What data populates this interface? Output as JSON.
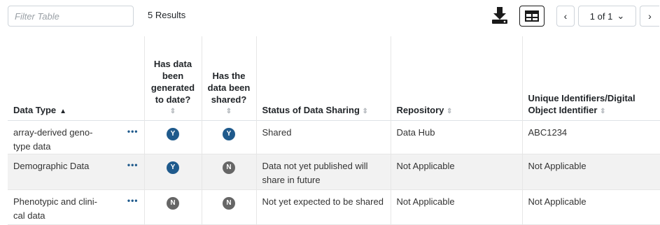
{
  "toolbar": {
    "filter_placeholder": "Filter Table",
    "results_text": "5 Results",
    "pagination": {
      "page_label": "1 of 1",
      "prev_symbol": "‹",
      "next_symbol": "›",
      "dropdown_symbol": "⌄"
    }
  },
  "table": {
    "headers": [
      {
        "label": "Data Type",
        "sort": "asc",
        "sort_symbol": "▲"
      },
      {
        "label": "Has data been generated to date?",
        "sort_symbol": "⇕"
      },
      {
        "label": "Has the data been shared?",
        "sort_symbol": "⇕"
      },
      {
        "label": "Status of Data Sharing",
        "sort_symbol": "⇕"
      },
      {
        "label": "Repository",
        "sort_symbol": "⇕"
      },
      {
        "label": "Unique Identifiers/Digital Object Identifier",
        "sort_symbol": "⇕"
      }
    ],
    "rows": [
      {
        "data_type": "array-derived geno- type data",
        "more": "•••",
        "generated": "Y",
        "shared": "Y",
        "status": "Shared",
        "repository": "Data Hub",
        "identifier": "ABC1234"
      },
      {
        "data_type": "Demographic Data",
        "more": "•••",
        "generated": "Y",
        "shared": "N",
        "status": "Data not yet published will share in future",
        "repository": "Not Applicable",
        "identifier": "Not Applicable"
      },
      {
        "data_type": "Phenotypic and clini- cal data",
        "more": "•••",
        "generated": "N",
        "shared": "N",
        "status": "Not yet expected to be shared",
        "repository": "Not Applicable",
        "identifier": "Not Applicable"
      }
    ]
  },
  "colors": {
    "badge_yes": "#1f5a8c",
    "badge_no": "#666666",
    "accent": "#1f5a8c"
  }
}
